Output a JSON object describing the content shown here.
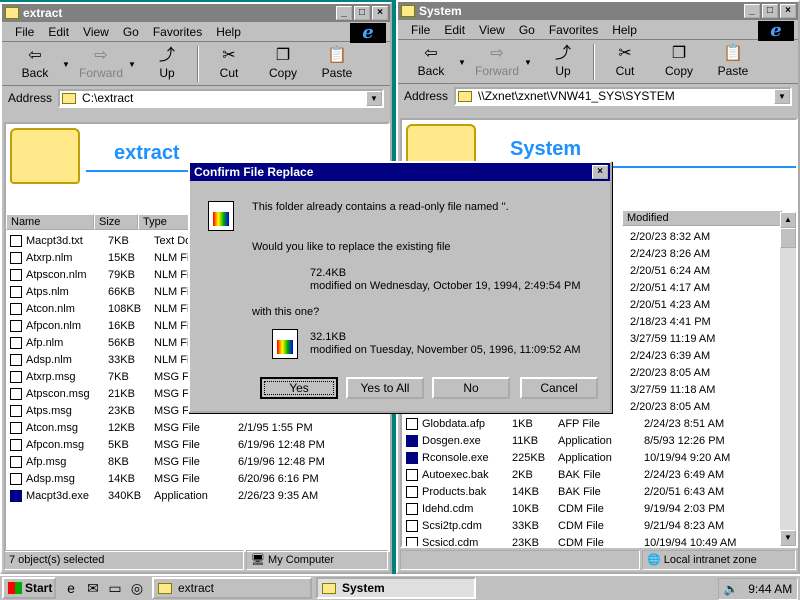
{
  "left_window": {
    "title": "extract",
    "menu": [
      "File",
      "Edit",
      "View",
      "Go",
      "Favorites",
      "Help"
    ],
    "toolbar": {
      "back": "Back",
      "forward": "Forward",
      "up": "Up",
      "cut": "Cut",
      "copy": "Copy",
      "paste": "Paste"
    },
    "address_label": "Address",
    "address_value": "C:\\extract",
    "folder_title": "extract",
    "columns": [
      "Name",
      "Size",
      "Type"
    ],
    "rows": [
      {
        "name": "Macpt3d.txt",
        "size": "7KB",
        "type": "Text Docu",
        "modified": ""
      },
      {
        "name": "Atxrp.nlm",
        "size": "15KB",
        "type": "NLM File",
        "modified": ""
      },
      {
        "name": "Atpscon.nlm",
        "size": "79KB",
        "type": "NLM File",
        "modified": ""
      },
      {
        "name": "Atps.nlm",
        "size": "66KB",
        "type": "NLM File",
        "modified": ""
      },
      {
        "name": "Atcon.nlm",
        "size": "108KB",
        "type": "NLM File",
        "modified": ""
      },
      {
        "name": "Afpcon.nlm",
        "size": "16KB",
        "type": "NLM File",
        "modified": ""
      },
      {
        "name": "Afp.nlm",
        "size": "56KB",
        "type": "NLM File",
        "modified": ""
      },
      {
        "name": "Adsp.nlm",
        "size": "33KB",
        "type": "NLM File",
        "modified": ""
      },
      {
        "name": "Atxrp.msg",
        "size": "7KB",
        "type": "MSG File",
        "modified": ""
      },
      {
        "name": "Atpscon.msg",
        "size": "21KB",
        "type": "MSG File",
        "modified": ""
      },
      {
        "name": "Atps.msg",
        "size": "23KB",
        "type": "MSG File",
        "modified": ""
      },
      {
        "name": "Atcon.msg",
        "size": "12KB",
        "type": "MSG File",
        "modified": "2/1/95 1:55 PM"
      },
      {
        "name": "Afpcon.msg",
        "size": "5KB",
        "type": "MSG File",
        "modified": "6/19/96 12:48 PM"
      },
      {
        "name": "Afp.msg",
        "size": "8KB",
        "type": "MSG File",
        "modified": "6/19/96 12:48 PM"
      },
      {
        "name": "Adsp.msg",
        "size": "14KB",
        "type": "MSG File",
        "modified": "6/20/96 6:16 PM"
      },
      {
        "name": "Macpt3d.exe",
        "size": "340KB",
        "type": "Application",
        "modified": "2/26/23 9:35 AM"
      }
    ],
    "status_count": "7 object(s) selected",
    "status_location": "My Computer"
  },
  "right_window": {
    "title": "System",
    "menu": [
      "File",
      "Edit",
      "View",
      "Go",
      "Favorites",
      "Help"
    ],
    "toolbar": {
      "back": "Back",
      "forward": "Forward",
      "up": "Up",
      "cut": "Cut",
      "copy": "Copy",
      "paste": "Paste"
    },
    "address_label": "Address",
    "address_value": "\\\\Zxnet\\zxnet\\VNW41_SYS\\SYSTEM",
    "folder_title": "System",
    "modified_header": "Modified",
    "top_dates": [
      "2/20/23 8:32 AM",
      "2/24/23 8:26 AM",
      "2/20/51 6:24 AM",
      "2/20/51 4:17 AM",
      "2/20/51 4:23 AM",
      "2/18/23 4:41 PM",
      "3/27/59 11:19 AM",
      "2/24/23 6:39 AM",
      "2/20/23 8:05 AM",
      "3/27/59 11:18 AM",
      "2/20/23 8:05 AM"
    ],
    "rows": [
      {
        "name": "Globdata.afp",
        "size": "1KB",
        "type": "AFP File",
        "modified": "2/24/23 8:51 AM"
      },
      {
        "name": "Dosgen.exe",
        "size": "11KB",
        "type": "Application",
        "modified": "8/5/93 12:26 PM"
      },
      {
        "name": "Rconsole.exe",
        "size": "225KB",
        "type": "Application",
        "modified": "10/19/94 9:20 AM"
      },
      {
        "name": "Autoexec.bak",
        "size": "2KB",
        "type": "BAK File",
        "modified": "2/24/23 6:49 AM"
      },
      {
        "name": "Products.bak",
        "size": "14KB",
        "type": "BAK File",
        "modified": "2/20/51 6:43 AM"
      },
      {
        "name": "Idehd.cdm",
        "size": "10KB",
        "type": "CDM File",
        "modified": "9/19/94 2:03 PM"
      },
      {
        "name": "Scsi2tp.cdm",
        "size": "33KB",
        "type": "CDM File",
        "modified": "9/21/94 8:23 AM"
      },
      {
        "name": "Scsicd.cdm",
        "size": "23KB",
        "type": "CDM File",
        "modified": "10/19/94 10:49 AM"
      }
    ],
    "status_zone": "Local intranet zone"
  },
  "dialog": {
    "title": "Confirm File Replace",
    "line1": "This folder already contains a read-only file named ''.",
    "line2": "Would you like to replace the existing file",
    "existing_size": "72.4KB",
    "existing_modified": "modified on Wednesday, October 19, 1994, 2:49:54 PM",
    "line3": "with this one?",
    "new_size": "32.1KB",
    "new_modified": "modified on Tuesday, November 05, 1996, 11:09:52 AM",
    "buttons": {
      "yes": "Yes",
      "yes_all": "Yes to All",
      "no": "No",
      "cancel": "Cancel"
    }
  },
  "taskbar": {
    "start": "Start",
    "tasks": [
      "extract",
      "System"
    ],
    "clock": "9:44 AM"
  }
}
